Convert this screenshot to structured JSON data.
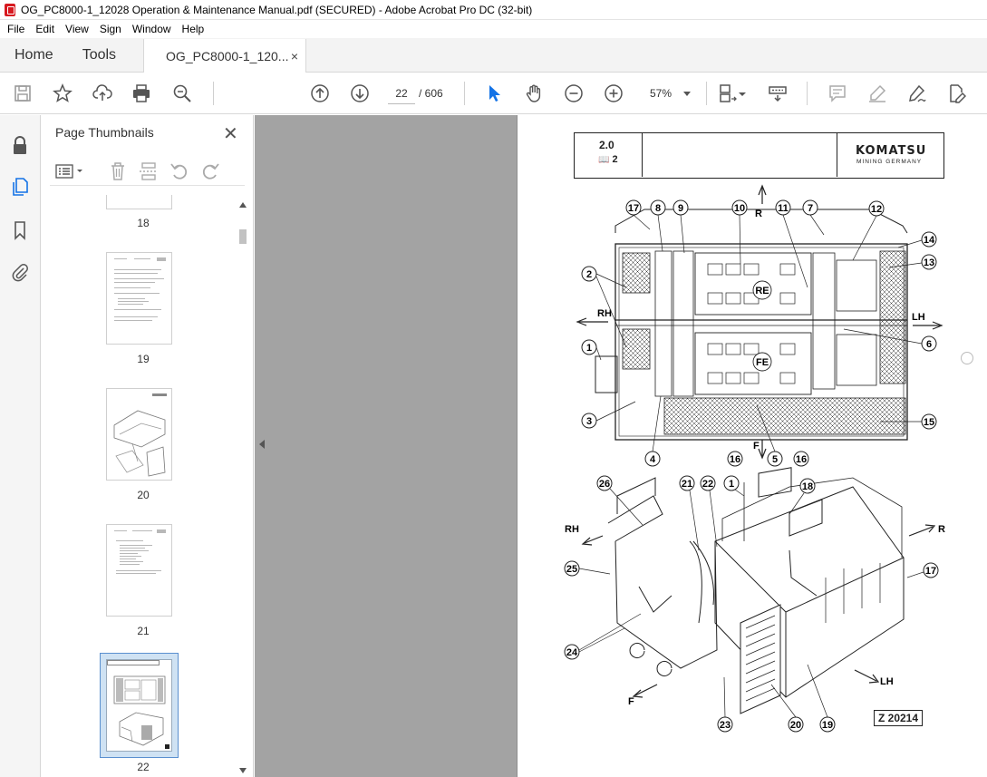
{
  "window": {
    "title": "OG_PC8000-1_12028 Operation & Maintenance Manual.pdf (SECURED) - Adobe Acrobat Pro DC (32-bit)"
  },
  "menu": [
    "File",
    "Edit",
    "View",
    "Sign",
    "Window",
    "Help"
  ],
  "tabs": {
    "home": "Home",
    "tools": "Tools",
    "document": "OG_PC8000-1_120...",
    "close": "×"
  },
  "toolbar": {
    "current_page": "22",
    "total_pages": "/ 606",
    "zoom": "57%"
  },
  "thumbnails": {
    "title": "Page Thumbnails",
    "close": "✕",
    "pages": [
      {
        "label": "18"
      },
      {
        "label": "19"
      },
      {
        "label": "20"
      },
      {
        "label": "21"
      },
      {
        "label": "22",
        "selected": true
      }
    ]
  },
  "page": {
    "section": "2.0",
    "book": "2",
    "brand": "KOMATSU",
    "brand_sub": "MINING GERMANY",
    "figure_id": "Z 20214",
    "direction_labels": {
      "r_top": "R",
      "rh_top": "RH",
      "lh_top": "LH",
      "f_top": "F",
      "re": "RE",
      "fe": "FE",
      "rh_bottom": "RH",
      "r_bottom": "R",
      "lh_bottom": "LH",
      "f_bottom": "F"
    },
    "top_callouts": [
      "17",
      "8",
      "9",
      "10",
      "11",
      "7",
      "12",
      "14",
      "13",
      "2",
      "6",
      "1",
      "3",
      "15",
      "4",
      "16",
      "5",
      "16"
    ],
    "bottom_callouts": [
      "26",
      "21",
      "22",
      "1",
      "18",
      "25",
      "17",
      "24",
      "23",
      "20",
      "19"
    ]
  },
  "colors": {
    "doc_background": "#a3a3a3",
    "selected_thumb": "#cfe2f3",
    "accent_blue": "#1473e6",
    "acrobat_red": "#d71920"
  }
}
